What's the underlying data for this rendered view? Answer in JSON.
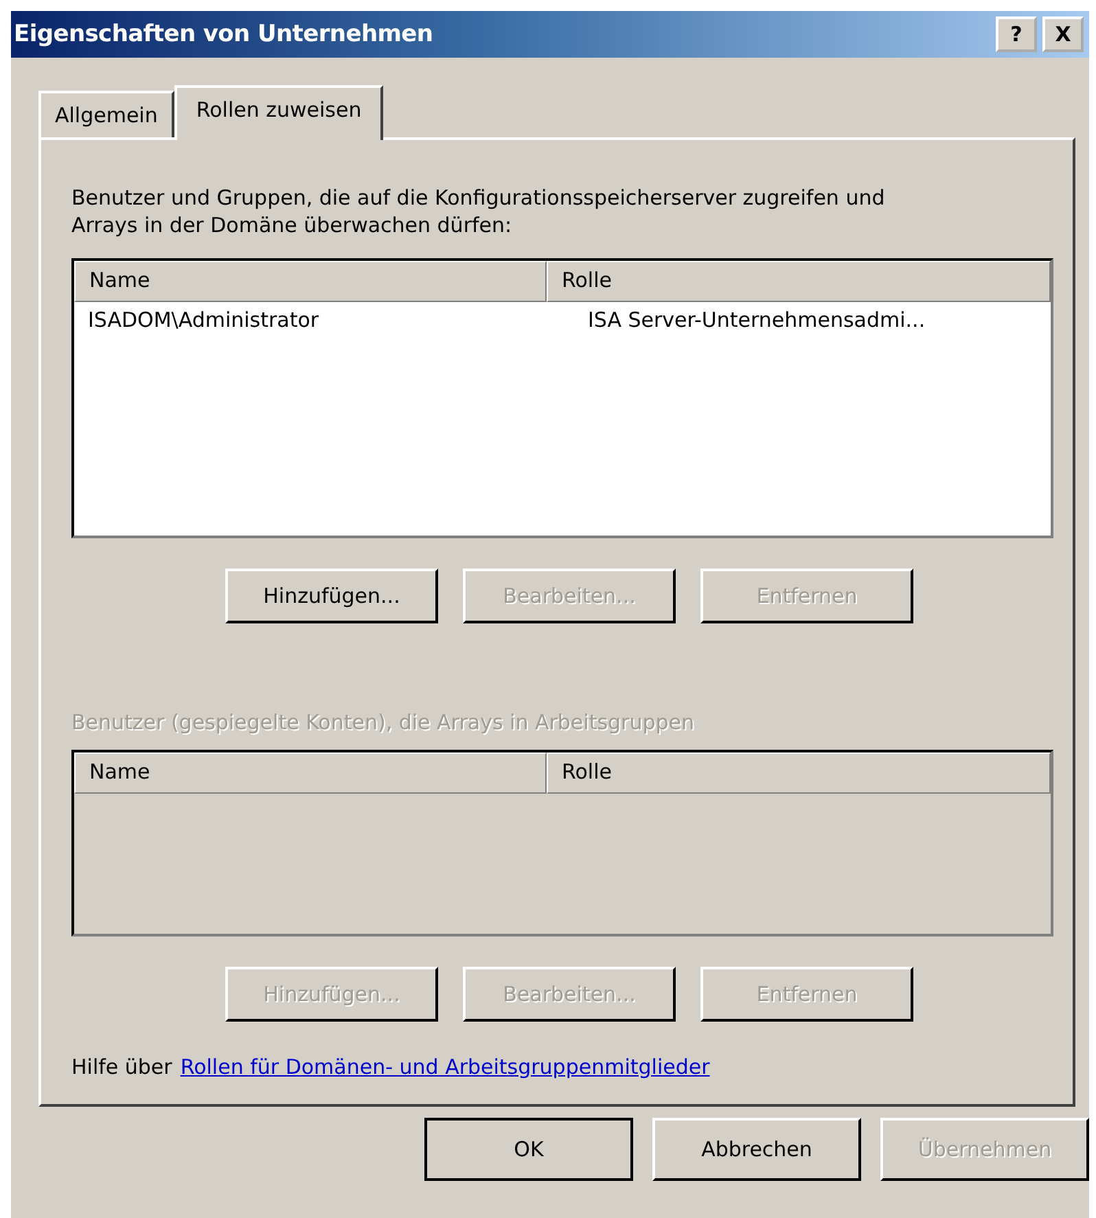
{
  "window": {
    "title": "Eigenschaften von Unternehmen",
    "title_buttons": [
      "?",
      "X"
    ]
  },
  "tabs": [
    {
      "label": "Allgemein",
      "selected": false
    },
    {
      "label": "Rollen zuweisen",
      "selected": true
    }
  ],
  "groups": [
    {
      "label": "Benutzer und Gruppen, die auf die Konfigurationsspeicherserver zugreifen und Arrays in der Domäne überwachen dürfen:",
      "disabled": false,
      "columns": [
        "Name",
        "Rolle"
      ],
      "rows": [
        [
          "ISADOM\\Administrator",
          "ISA Server-Unternehmensadmi..."
        ]
      ],
      "buttons": [
        {
          "label": "Hinzufügen...",
          "disabled": false
        },
        {
          "label": "Bearbeiten...",
          "disabled": true
        },
        {
          "label": "Entfernen",
          "disabled": true
        }
      ]
    },
    {
      "label": "Benutzer (gespiegelte Konten), die Arrays in Arbeitsgruppen",
      "disabled": true,
      "columns": [
        "Name",
        "Rolle"
      ],
      "buttons": [
        {
          "label": "Hinzufügen...",
          "disabled": true
        },
        {
          "label": "Bearbeiten...",
          "disabled": true
        },
        {
          "label": "Entfernen",
          "disabled": true
        }
      ]
    }
  ],
  "help": {
    "text": "Hilfe über",
    "link": "Rollen für Domänen- und Arbeitsgruppenmitglieder"
  },
  "footer_buttons": [
    {
      "label": "OK",
      "disabled": false,
      "default": true
    },
    {
      "label": "Abbrechen",
      "disabled": false,
      "default": false
    },
    {
      "label": "Übernehmen",
      "disabled": true,
      "default": false
    }
  ]
}
